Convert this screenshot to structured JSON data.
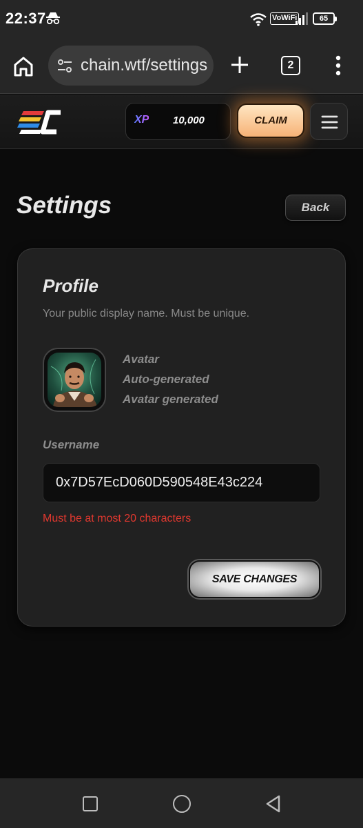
{
  "status_bar": {
    "time": "22:37",
    "vowifi": "VoWiFi",
    "battery": "65",
    "icons": [
      "incognito-icon",
      "wifi-icon",
      "signal-icon",
      "battery-icon"
    ]
  },
  "browser": {
    "url": "chain.wtf/settings",
    "tab_count": "2",
    "icons": [
      "home-icon",
      "site-settings-icon",
      "new-tab-plus-icon",
      "tab-switcher-icon",
      "more-vert-icon"
    ]
  },
  "header": {
    "logo": "EC",
    "xp_badge": "XP",
    "xp_value": "10,000",
    "claim_label": "CLAIM",
    "menu_icon": "hamburger-icon"
  },
  "page": {
    "title": "Settings",
    "back_label": "Back"
  },
  "profile": {
    "title": "Profile",
    "description": "Your public display name. Must be unique.",
    "avatar_lines": [
      "Avatar",
      "Auto-generated",
      "Avatar generated"
    ],
    "username_label": "Username",
    "username_value": "0x7D57EcD060D590548E43c224",
    "error": "Must be at most 20 characters",
    "save_label": "SAVE CHANGES"
  },
  "colors": {
    "background": "#0b0b0b",
    "card": "#212121",
    "claim_accent": "#f6b277",
    "error": "#e0382f",
    "xp_gradient": [
      "#5c7cff",
      "#c45cff"
    ]
  },
  "nav": {
    "icons": [
      "recent-apps-icon",
      "home-circle-icon",
      "back-triangle-icon"
    ]
  }
}
